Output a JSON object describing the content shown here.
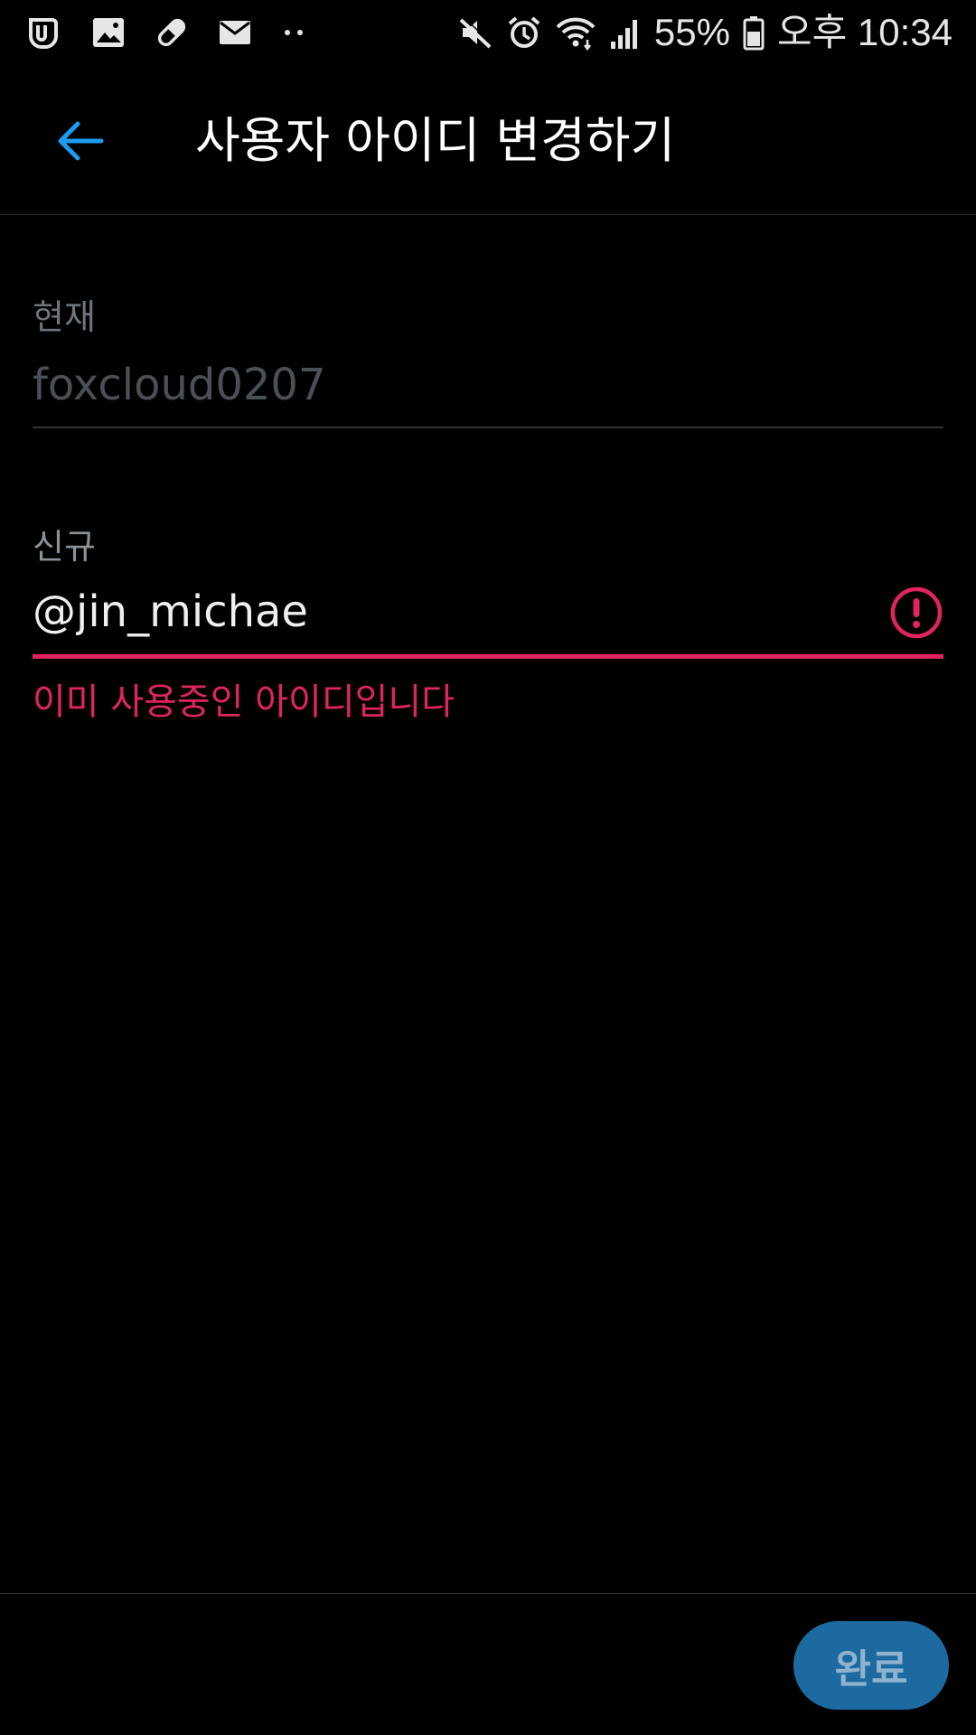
{
  "status_bar": {
    "left_icons": [
      "app-notification-icon",
      "image-icon",
      "pill-icon",
      "mail-icon",
      "more-dots-icon"
    ],
    "right_icons": [
      "mute-icon",
      "alarm-icon",
      "wifi-icon",
      "signal-icon",
      "battery-icon"
    ],
    "battery_percent": "55%",
    "time": "오후 10:34"
  },
  "app_bar": {
    "back_icon": "arrow-left-icon",
    "title": "사용자 아이디 변경하기",
    "accent_color": "#1d9bf0"
  },
  "form": {
    "current": {
      "label": "현재",
      "value": "foxcloud0207"
    },
    "new": {
      "label": "신규",
      "prefix": "@",
      "value": "jin_michae",
      "error_icon": "exclamation-circle-icon",
      "error_message": "이미 사용중인 아이디입니다",
      "error_color": "#e0245e"
    }
  },
  "bottom_bar": {
    "done_label": "완료",
    "done_color": "#1d6aa0"
  }
}
